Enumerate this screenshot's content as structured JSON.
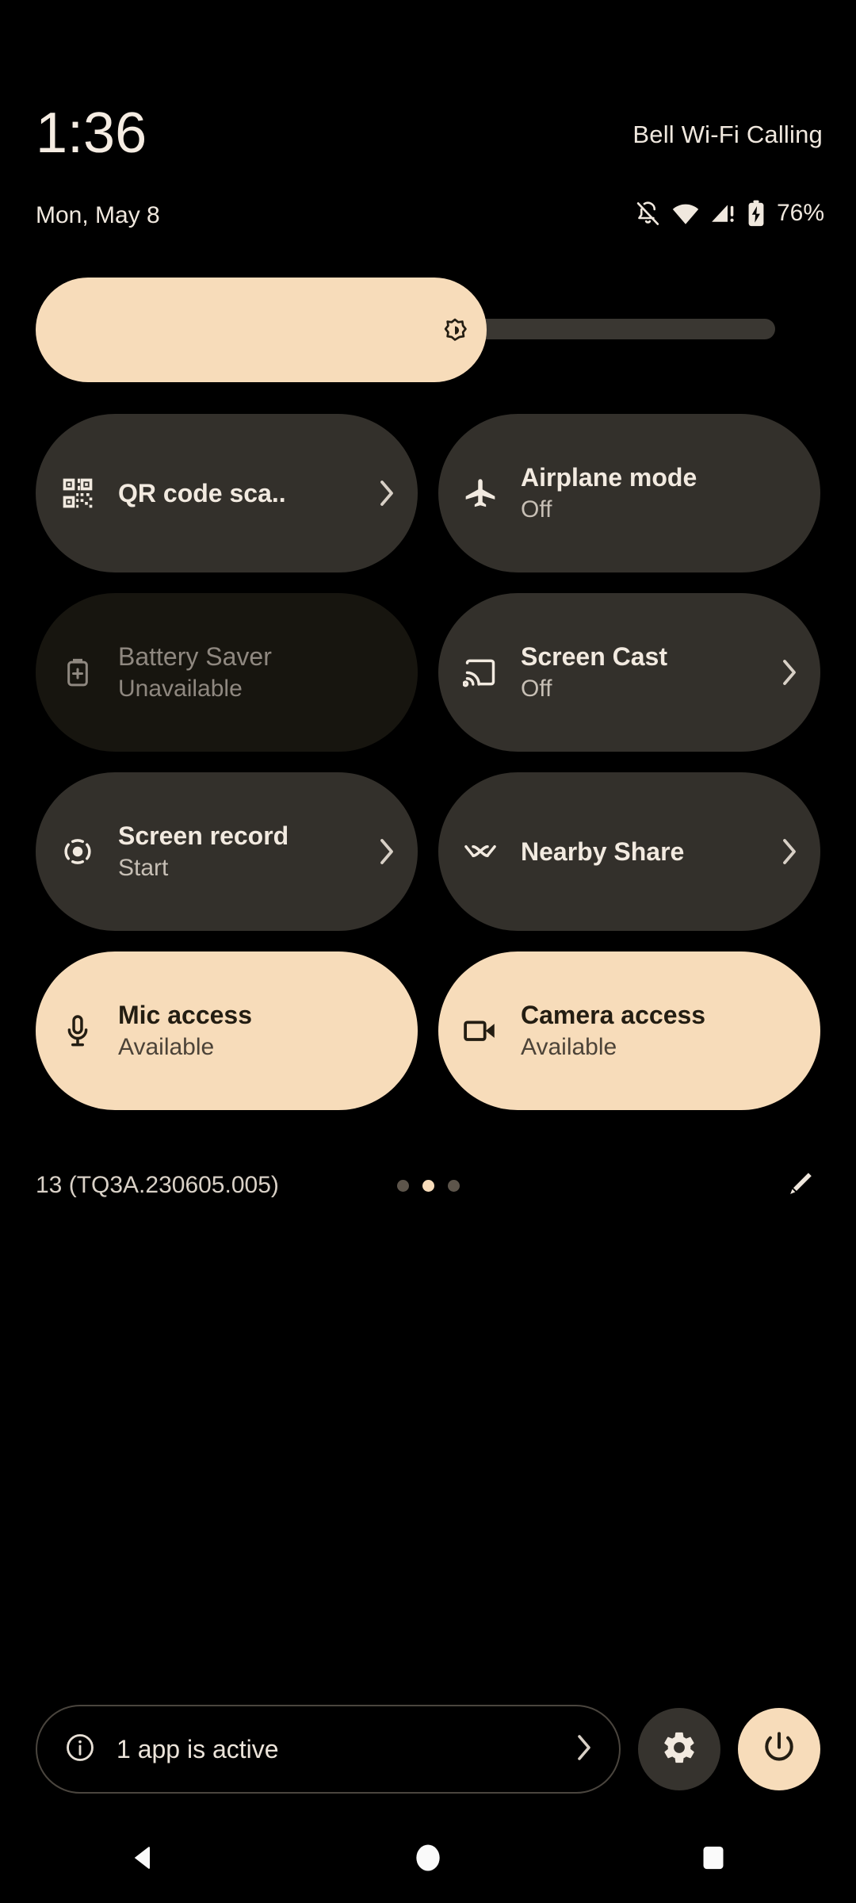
{
  "statusbar": {
    "clock": "1:36",
    "date": "Mon, May 8",
    "carrier": "Bell Wi-Fi Calling",
    "battery_percent": "76%",
    "icons": [
      "notifications-off-icon",
      "wifi-icon",
      "cell-signal-alert-icon",
      "battery-charging-icon"
    ]
  },
  "brightness": {
    "name": "brightness-slider",
    "icon": "brightness-icon",
    "fill_percent": 61,
    "fill_color": "#f7dcba",
    "track_color": "#3a3732"
  },
  "tiles": [
    {
      "label": "QR code sca..",
      "sub": "",
      "icon": "qr-code-icon",
      "state": "inactive",
      "chevron": true,
      "name": "tile-qr-code-scanner"
    },
    {
      "label": "Airplane mode",
      "sub": "Off",
      "icon": "airplane-icon",
      "state": "inactive",
      "chevron": false,
      "name": "tile-airplane-mode"
    },
    {
      "label": "Battery Saver",
      "sub": "Unavailable",
      "icon": "battery-saver-icon",
      "state": "disabled",
      "chevron": false,
      "name": "tile-battery-saver"
    },
    {
      "label": "Screen Cast",
      "sub": "Off",
      "icon": "cast-icon",
      "state": "inactive",
      "chevron": true,
      "name": "tile-screen-cast"
    },
    {
      "label": "Screen record",
      "sub": "Start",
      "icon": "screen-record-icon",
      "state": "inactive",
      "chevron": true,
      "name": "tile-screen-record"
    },
    {
      "label": "Nearby Share",
      "sub": "",
      "icon": "nearby-share-icon",
      "state": "inactive",
      "chevron": true,
      "name": "tile-nearby-share"
    },
    {
      "label": "Mic access",
      "sub": "Available",
      "icon": "microphone-icon",
      "state": "active",
      "chevron": false,
      "name": "tile-mic-access"
    },
    {
      "label": "Camera access",
      "sub": "Available",
      "icon": "camera-icon",
      "state": "active",
      "chevron": false,
      "name": "tile-camera-access"
    }
  ],
  "qs_footer": {
    "build": "13 (TQ3A.230605.005)",
    "page_count": 3,
    "active_page": 2,
    "edit_icon": "pencil-icon"
  },
  "bottom_bar": {
    "apps_label": "1 app is active",
    "apps_info_icon": "info-icon",
    "apps_chevron_icon": "chevron-right-icon",
    "settings_icon": "gear-icon",
    "power_icon": "power-icon"
  },
  "navbar": {
    "back": "back-triangle-icon",
    "home": "home-circle-icon",
    "recents": "recents-square-icon"
  },
  "colors": {
    "background": "#000000",
    "tile": "#33302b",
    "tile_active": "#f7dcba",
    "tile_disabled": "#17150f",
    "text": "#f2eae0",
    "text_secondary": "#c7bfb5"
  }
}
